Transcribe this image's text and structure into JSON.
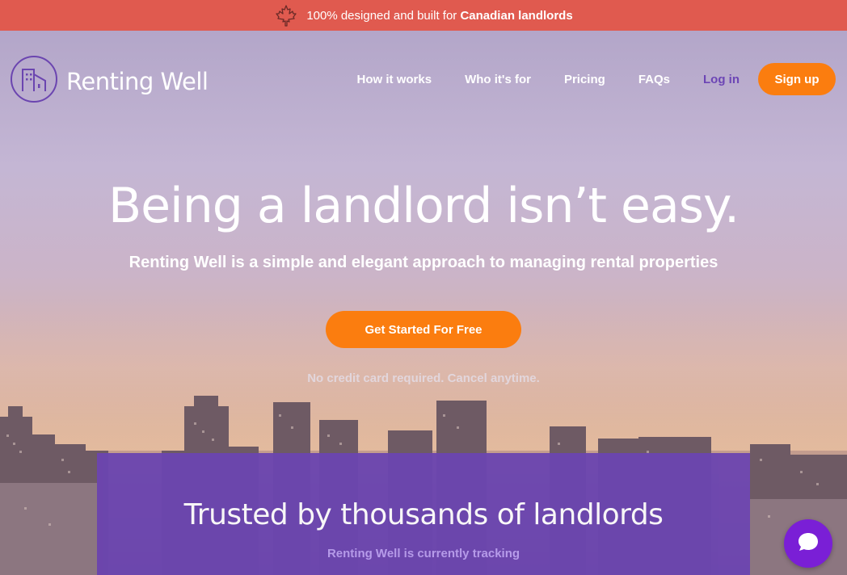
{
  "banner": {
    "icon": "maple-leaf-icon",
    "text": "100% designed and built for",
    "highlight": "Canadian landlords"
  },
  "brand": {
    "name": "Renting Well",
    "icon": "buildings-logo-icon"
  },
  "nav": {
    "links": [
      "How it works",
      "Who it's for",
      "Pricing",
      "FAQs"
    ],
    "login": "Log in",
    "signup": "Sign up"
  },
  "hero": {
    "headline": "Being a landlord isn’t easy.",
    "subhead": "Renting Well is a simple and elegant approach to managing rental properties",
    "cta": "Get Started For Free",
    "note": "No credit card required. Cancel anytime."
  },
  "trusted": {
    "title": "Trusted by thousands of landlords",
    "subtitle": "Renting Well is currently tracking"
  },
  "chat": {
    "icon": "chat-bubble-icon"
  },
  "colors": {
    "banner": "#e05a4f",
    "accent_orange": "#fb7d0f",
    "purple": "#6b45b0",
    "login_purple": "#6c45b5",
    "chat": "#7a1fd6"
  }
}
